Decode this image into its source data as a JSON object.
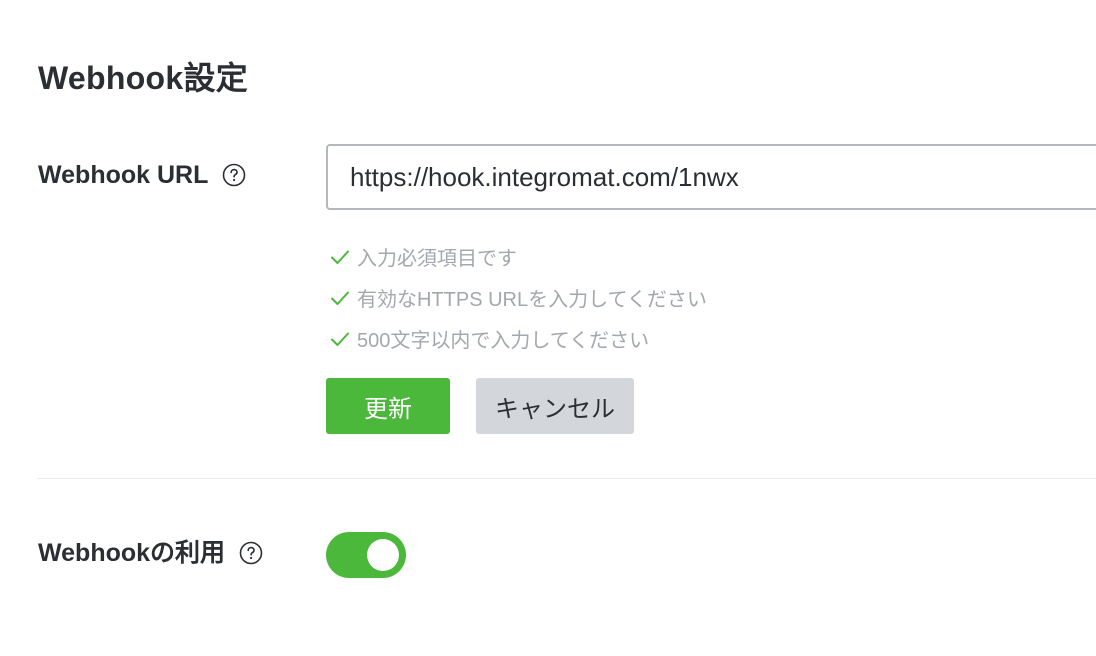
{
  "section": {
    "title": "Webhook設定"
  },
  "webhook_url": {
    "label": "Webhook URL",
    "help_icon": "question-circle-icon",
    "value": "https://hook.integromat.com/1nwx"
  },
  "validation": {
    "check_icon": "check-icon",
    "check_color": "#4cb83b",
    "rules": [
      {
        "text": "入力必須項目です"
      },
      {
        "text": "有効なHTTPS URLを入力してください"
      },
      {
        "text": "500文字以内で入力してください"
      }
    ]
  },
  "actions": {
    "update_label": "更新",
    "cancel_label": "キャンセル"
  },
  "webhook_use": {
    "label": "Webhookの利用",
    "help_icon": "question-circle-icon",
    "enabled": true
  },
  "colors": {
    "accent": "#4cb83b",
    "secondary_button": "#d3d6da",
    "text": "#2b2f33",
    "muted_text": "#a3a8ae"
  }
}
